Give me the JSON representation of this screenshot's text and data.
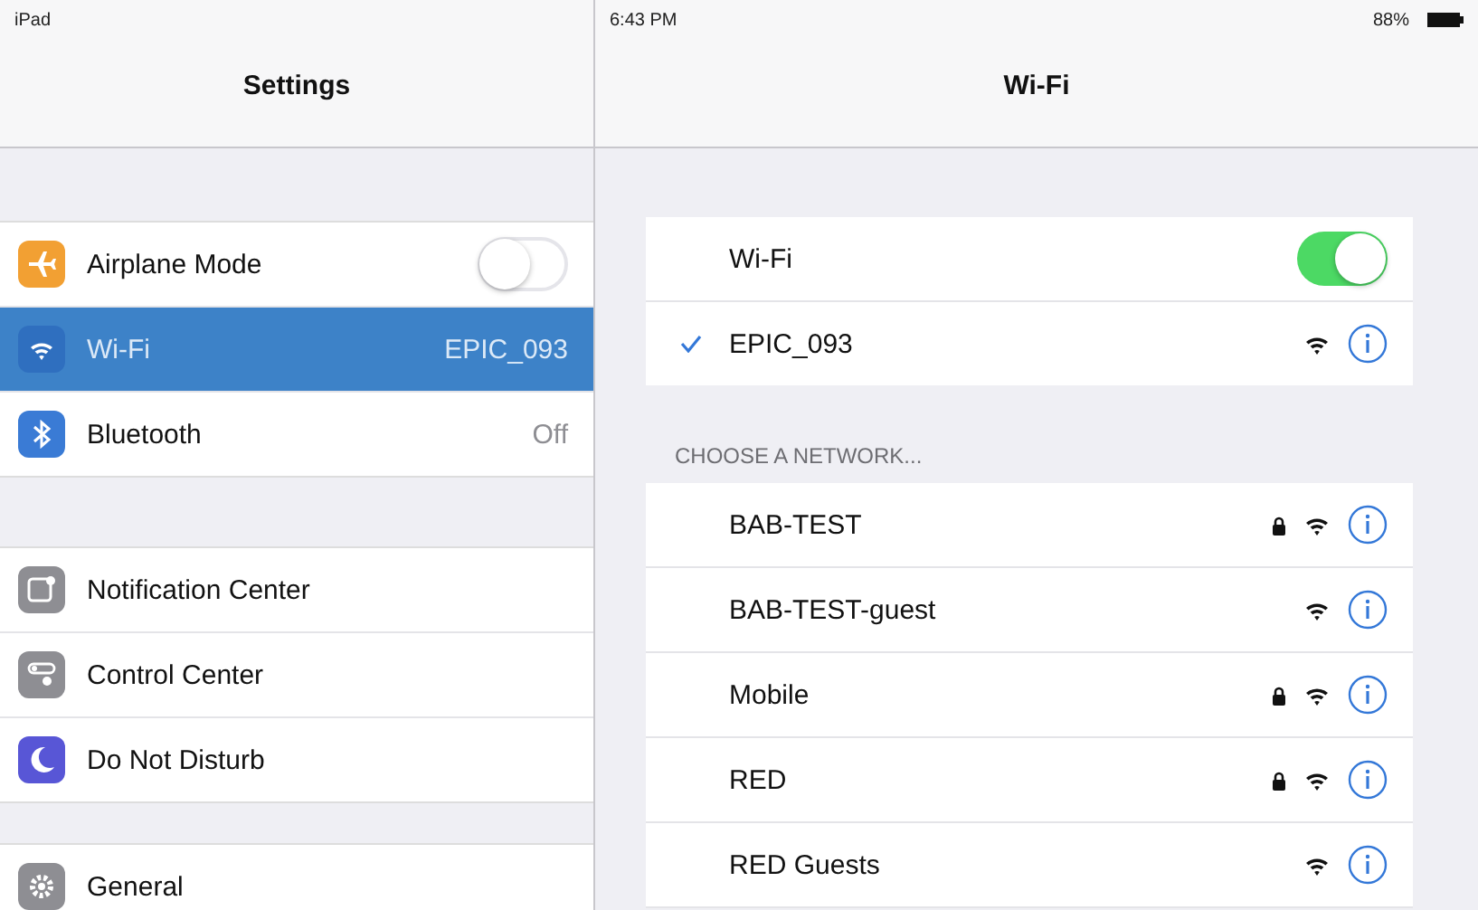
{
  "status_bar": {
    "device": "iPad",
    "time": "6:43 PM",
    "battery": "88%"
  },
  "sidebar": {
    "title": "Settings",
    "groups": [
      [
        {
          "label": "Airplane Mode",
          "color": "#f2a033",
          "kind": "toggle",
          "on": false,
          "selected": false
        },
        {
          "label": "Wi-Fi",
          "color": "#2f6fbf",
          "kind": "value",
          "value": "EPIC_093",
          "selected": true
        },
        {
          "label": "Bluetooth",
          "color": "#3a7bd5",
          "kind": "value",
          "value": "Off",
          "selected": false
        }
      ],
      [
        {
          "label": "Notification Center",
          "color": "#8e8e93",
          "kind": "plain",
          "selected": false
        },
        {
          "label": "Control Center",
          "color": "#8e8e93",
          "kind": "plain",
          "selected": false
        },
        {
          "label": "Do Not Disturb",
          "color": "#5856d6",
          "kind": "plain",
          "selected": false
        }
      ],
      [
        {
          "label": "General",
          "color": "#8e8e93",
          "kind": "plain",
          "selected": false
        }
      ]
    ]
  },
  "detail": {
    "title": "Wi-Fi",
    "wifi": {
      "label": "Wi-Fi",
      "on": true
    },
    "current": {
      "name": "EPIC_093",
      "connected": true,
      "locked": false
    },
    "section_header": "CHOOSE A NETWORK...",
    "networks": [
      {
        "name": "BAB-TEST",
        "locked": true
      },
      {
        "name": "BAB-TEST-guest",
        "locked": false
      },
      {
        "name": "Mobile",
        "locked": true
      },
      {
        "name": "RED",
        "locked": true
      },
      {
        "name": "RED Guests",
        "locked": false
      }
    ]
  }
}
